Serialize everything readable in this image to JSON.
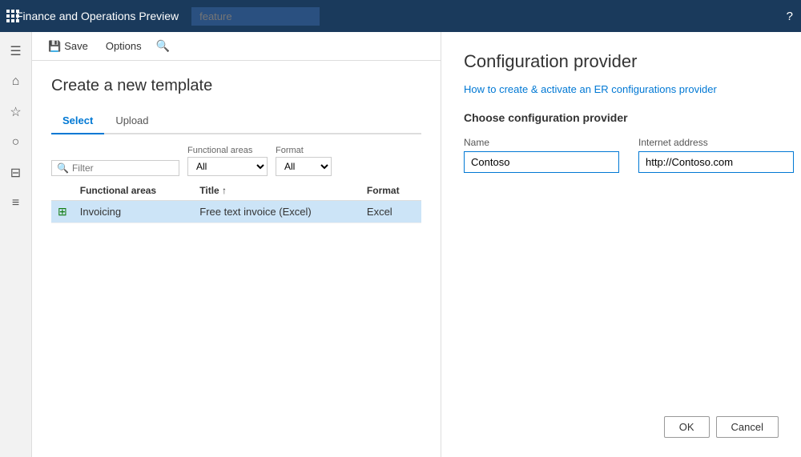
{
  "topbar": {
    "app_title": "Finance and Operations Preview",
    "search_placeholder": "feature"
  },
  "toolbar": {
    "save_label": "Save",
    "options_label": "Options"
  },
  "page": {
    "title": "Create a new template"
  },
  "tabs": [
    {
      "id": "select",
      "label": "Select",
      "active": true
    },
    {
      "id": "upload",
      "label": "Upload",
      "active": false
    }
  ],
  "filter": {
    "placeholder": "Filter",
    "functional_areas_label": "Functional areas",
    "functional_areas_value": "All",
    "format_label": "Format",
    "format_value": "All"
  },
  "table": {
    "columns": [
      {
        "id": "functional_areas",
        "label": "Functional areas"
      },
      {
        "id": "title",
        "label": "Title ↑"
      },
      {
        "id": "format",
        "label": "Format"
      }
    ],
    "rows": [
      {
        "id": 1,
        "icon": "📊",
        "functional_areas": "Invoicing",
        "title": "Free text invoice (Excel)",
        "format": "Excel",
        "selected": true
      }
    ]
  },
  "right_panel": {
    "title": "Configuration provider",
    "link": "How to create & activate an ER configurations provider",
    "subtitle": "Choose configuration provider",
    "name_label": "Name",
    "name_value": "Contoso",
    "internet_address_label": "Internet address",
    "internet_address_value": "http://Contoso.com",
    "ok_label": "OK",
    "cancel_label": "Cancel"
  },
  "sidebar": {
    "icons": [
      {
        "name": "hamburger-icon",
        "symbol": "☰"
      },
      {
        "name": "home-icon",
        "symbol": "⌂"
      },
      {
        "name": "star-icon",
        "symbol": "★"
      },
      {
        "name": "clock-icon",
        "symbol": "🕐"
      },
      {
        "name": "location-icon",
        "symbol": "⊞"
      },
      {
        "name": "list-icon",
        "symbol": "☰"
      }
    ]
  }
}
